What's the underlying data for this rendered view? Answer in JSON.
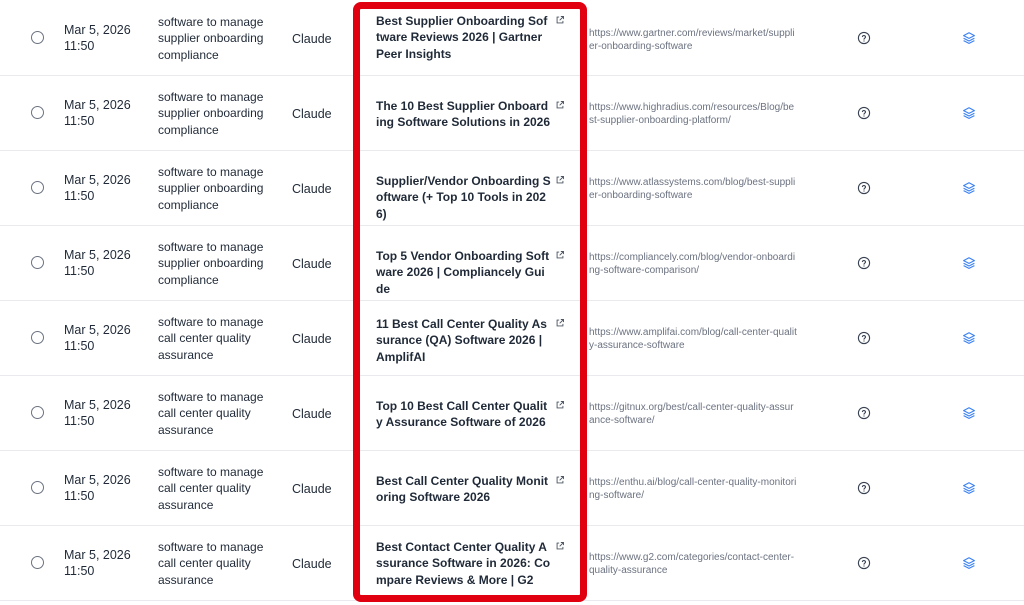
{
  "colors": {
    "highlight": "#e0000f",
    "layers_icon": "#3b82f6",
    "muted_text": "#6b7280"
  },
  "icons": {
    "row_select": "radio-circle",
    "external": "external-link-icon",
    "help": "question-circle-icon",
    "sources": "layers-icon"
  },
  "rows": [
    {
      "date": "Mar 5, 2026 11:50",
      "query": "software to manage supplier onboarding compliance",
      "model": "Claude",
      "title": "Best Supplier Onboarding Software Reviews 2026 | Gartner Peer Insights",
      "url": "https://www.gartner.com/reviews/market/supplier-onboarding-software"
    },
    {
      "date": "Mar 5, 2026 11:50",
      "query": "software to manage supplier onboarding compliance",
      "model": "Claude",
      "title": "The 10 Best Supplier Onboarding Software Solutions in 2026",
      "url": "https://www.highradius.com/resources/Blog/best-supplier-onboarding-platform/"
    },
    {
      "date": "Mar 5, 2026 11:50",
      "query": "software to manage supplier onboarding compliance",
      "model": "Claude",
      "title": "Supplier/Vendor Onboarding Software (+ Top 10 Tools in 2026)",
      "url": "https://www.atlassystems.com/blog/best-supplier-onboarding-software"
    },
    {
      "date": "Mar 5, 2026 11:50",
      "query": "software to manage supplier onboarding compliance",
      "model": "Claude",
      "title": "Top 5 Vendor Onboarding Software 2026 | Compliancely Guide",
      "url": "https://compliancely.com/blog/vendor-onboarding-software-comparison/"
    },
    {
      "date": "Mar 5, 2026 11:50",
      "query": "software to manage call center quality assurance",
      "model": "Claude",
      "title": "11 Best Call Center Quality Assurance (QA) Software 2026 | AmplifAI",
      "url": "https://www.amplifai.com/blog/call-center-quality-assurance-software"
    },
    {
      "date": "Mar 5, 2026 11:50",
      "query": "software to manage call center quality assurance",
      "model": "Claude",
      "title": "Top 10 Best Call Center Quality Assurance Software of 2026",
      "url": "https://gitnux.org/best/call-center-quality-assurance-software/"
    },
    {
      "date": "Mar 5, 2026 11:50",
      "query": "software to manage call center quality assurance",
      "model": "Claude",
      "title": "Best Call Center Quality Monitoring Software 2026",
      "url": "https://enthu.ai/blog/call-center-quality-monitoring-software/"
    },
    {
      "date": "Mar 5, 2026 11:50",
      "query": "software to manage call center quality assurance",
      "model": "Claude",
      "title": "Best Contact Center Quality Assurance Software in 2026: Compare Reviews & More | G2",
      "url": "https://www.g2.com/categories/contact-center-quality-assurance"
    }
  ]
}
